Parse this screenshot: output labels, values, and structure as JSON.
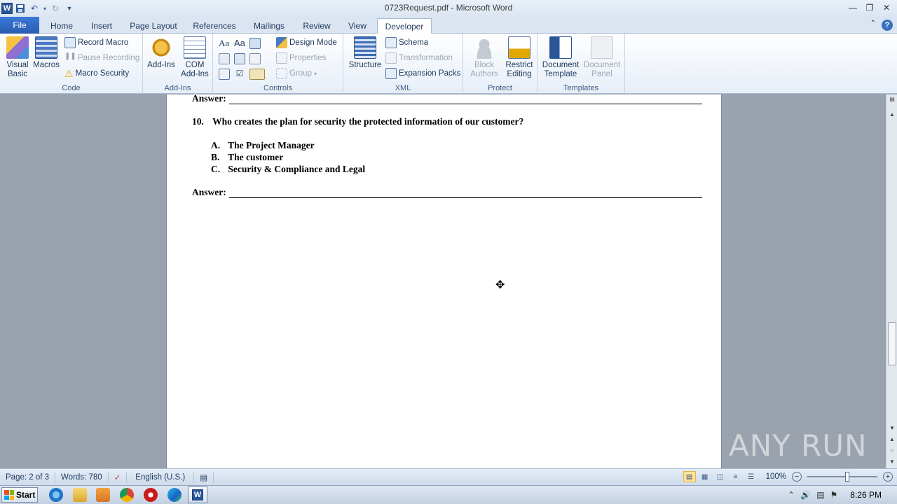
{
  "window": {
    "title": "0723Request.pdf  -  Microsoft Word",
    "app_letter": "W"
  },
  "tabs": [
    "File",
    "Home",
    "Insert",
    "Page Layout",
    "References",
    "Mailings",
    "Review",
    "View",
    "Developer"
  ],
  "active_tab": "Developer",
  "ribbon": {
    "code": {
      "label": "Code",
      "visual_basic": "Visual Basic",
      "macros": "Macros",
      "record_macro": "Record Macro",
      "pause_recording": "Pause Recording",
      "macro_security": "Macro Security"
    },
    "addins": {
      "label": "Add-Ins",
      "add_ins": "Add-Ins",
      "com_add_ins": "COM Add-Ins"
    },
    "controls": {
      "label": "Controls",
      "design_mode": "Design Mode",
      "properties": "Properties",
      "group": "Group",
      "rich_text": "Aa",
      "plain_text": "Aa"
    },
    "xml": {
      "label": "XML",
      "structure": "Structure",
      "schema": "Schema",
      "transformation": "Transformation",
      "expansion_packs": "Expansion Packs"
    },
    "protect": {
      "label": "Protect",
      "block_authors": "Block Authors",
      "restrict_editing": "Restrict Editing"
    },
    "templates": {
      "label": "Templates",
      "document_template": "Document Template",
      "document_panel": "Document Panel"
    }
  },
  "document": {
    "answer_label": "Answer:",
    "question": {
      "number": "10.",
      "text": "Who creates the plan for security the protected information of our customer?"
    },
    "options": [
      {
        "letter": "A.",
        "text": "The Project Manager"
      },
      {
        "letter": "B.",
        "text": "The customer"
      },
      {
        "letter": "C.",
        "text": "Security & Compliance and Legal"
      }
    ]
  },
  "statusbar": {
    "page": "Page: 2 of 3",
    "words": "Words: 780",
    "language": "English (U.S.)",
    "zoom": "100%",
    "zoom_percent": 100
  },
  "taskbar": {
    "start": "Start",
    "clock": "8:26 PM"
  },
  "watermark": "ANY RUN",
  "colors": {
    "accent": "#2a5cb0",
    "ribbon_bg": "#e6eef8",
    "doc_bg": "#9aa3ad"
  }
}
